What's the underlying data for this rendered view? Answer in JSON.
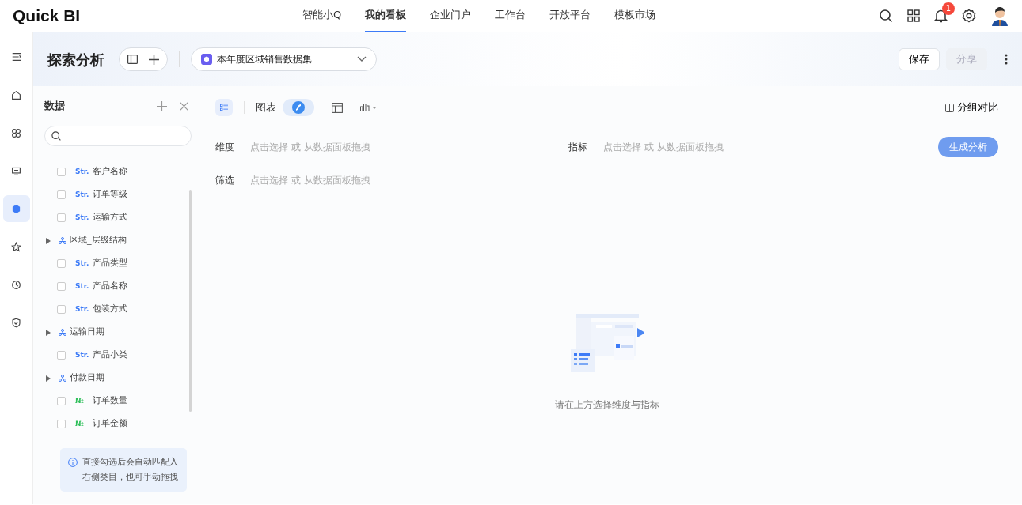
{
  "logo": "Quick BI",
  "nav": [
    {
      "label": "智能小Q",
      "selected": false
    },
    {
      "label": "我的看板",
      "selected": true
    },
    {
      "label": "企业门户",
      "selected": false
    },
    {
      "label": "工作台",
      "selected": false
    },
    {
      "label": "开放平台",
      "selected": false
    },
    {
      "label": "模板市场",
      "selected": false
    }
  ],
  "notification_count": "1",
  "sidebar": {
    "items": [
      {
        "selected": false
      },
      {
        "selected": false
      },
      {
        "selected": false
      },
      {
        "selected": true
      },
      {
        "selected": false
      },
      {
        "selected": false
      },
      {
        "selected": false
      }
    ]
  },
  "page": {
    "title": "探索分析",
    "dataset": "本年度区域销售数据集",
    "buttons": [
      {
        "label": "保存",
        "disabled": false
      },
      {
        "label": "分享",
        "disabled": true
      }
    ]
  },
  "data_panel": {
    "title": "数据",
    "fields": [
      {
        "kind": "field",
        "type_tag": "Str.",
        "color": "#3d7bf7",
        "label": "客户名称",
        "checked": false
      },
      {
        "kind": "field",
        "type_tag": "Str.",
        "color": "#3d7bf7",
        "label": "订单等级",
        "checked": false
      },
      {
        "kind": "field",
        "type_tag": "Str.",
        "color": "#3d7bf7",
        "label": "运输方式",
        "checked": false
      },
      {
        "kind": "group",
        "label": "区域_层级结构",
        "expanded": false
      },
      {
        "kind": "field",
        "type_tag": "Str.",
        "color": "#3d7bf7",
        "label": "产品类型",
        "checked": false
      },
      {
        "kind": "field",
        "type_tag": "Str.",
        "color": "#3d7bf7",
        "label": "产品名称",
        "checked": false
      },
      {
        "kind": "field",
        "type_tag": "Str.",
        "color": "#3d7bf7",
        "label": "包装方式",
        "checked": false
      },
      {
        "kind": "group",
        "label": "运输日期",
        "expanded": false
      },
      {
        "kind": "field",
        "type_tag": "Str.",
        "color": "#3d7bf7",
        "label": "产品小类",
        "checked": false
      },
      {
        "kind": "group",
        "label": "付款日期",
        "expanded": false
      },
      {
        "kind": "field",
        "type_tag": "№",
        "color": "#2fbf5a",
        "label": "订单数量",
        "checked": false
      },
      {
        "kind": "field",
        "type_tag": "№",
        "color": "#2fbf5a",
        "label": "订单金额",
        "checked": false
      }
    ],
    "tip": "直接勾选后会自动匹配入右侧类目，也可手动拖拽"
  },
  "toolbar": {
    "chart_label": "图表",
    "ai_toggle": {
      "on": true
    },
    "compare": "分组对比"
  },
  "slots": [
    {
      "label": "维度",
      "placeholder": "点击选择 或 从数据面板拖拽"
    },
    {
      "label": "指标",
      "placeholder": "点击选择 或 从数据面板拖拽"
    },
    {
      "label": "筛选",
      "placeholder": "点击选择 或 从数据面板拖拽"
    }
  ],
  "generate_button": {
    "label": "生成分析",
    "disabled": true
  },
  "empty_state": "请在上方选择维度与指标"
}
